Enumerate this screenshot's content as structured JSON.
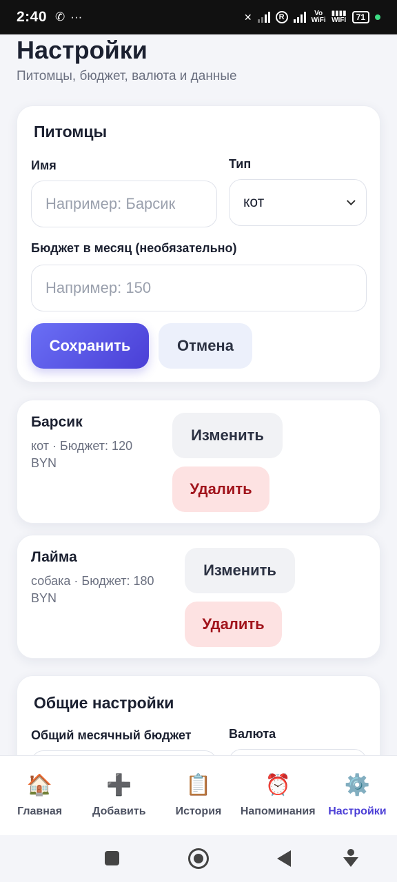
{
  "status_bar": {
    "time": "2:40",
    "left_icons": [
      "whatsapp-icon",
      "more-dots-icon"
    ],
    "right_icons": [
      "mute-icon",
      "signal-icon",
      "roaming-r-icon",
      "signal-icon",
      "vowifi-icon",
      "wifi-icon",
      "battery-icon"
    ],
    "vowifi_label_top": "Vo",
    "vowifi_label_bottom": "WiFi",
    "wifi_label": "WIFI",
    "battery_level": "71"
  },
  "header": {
    "title": "Настройки",
    "subtitle": "Питомцы, бюджет, валюта и данные"
  },
  "pet_form": {
    "title": "Питомцы",
    "name_label": "Имя",
    "name_placeholder": "Например: Барсик",
    "type_label": "Тип",
    "type_value": "кот",
    "budget_label": "Бюджет в месяц (необязательно)",
    "budget_placeholder": "Например: 150",
    "save_label": "Сохранить",
    "cancel_label": "Отмена"
  },
  "pets": [
    {
      "name": "Барсик",
      "meta": "кот · Бюджет: 120 BYN",
      "edit_label": "Изменить",
      "delete_label": "Удалить"
    },
    {
      "name": "Лайма",
      "meta": "собака · Бюджет: 180 BYN",
      "edit_label": "Изменить",
      "delete_label": "Удалить"
    }
  ],
  "general": {
    "title": "Общие настройки",
    "budget_label": "Общий месячный бюджет",
    "currency_label": "Валюта"
  },
  "bottom_nav": {
    "items": [
      {
        "label": "Главная",
        "icon": "house-icon"
      },
      {
        "label": "Добавить",
        "icon": "plus-icon"
      },
      {
        "label": "История",
        "icon": "clipboard-icon"
      },
      {
        "label": "Напоминания",
        "icon": "alarm-clock-icon"
      },
      {
        "label": "Настройки",
        "icon": "gear-icon"
      }
    ],
    "active": "Настройки"
  },
  "colors": {
    "accent": "#4c3fd6",
    "danger_text": "#a1141c",
    "danger_bg": "#fde2e2"
  }
}
